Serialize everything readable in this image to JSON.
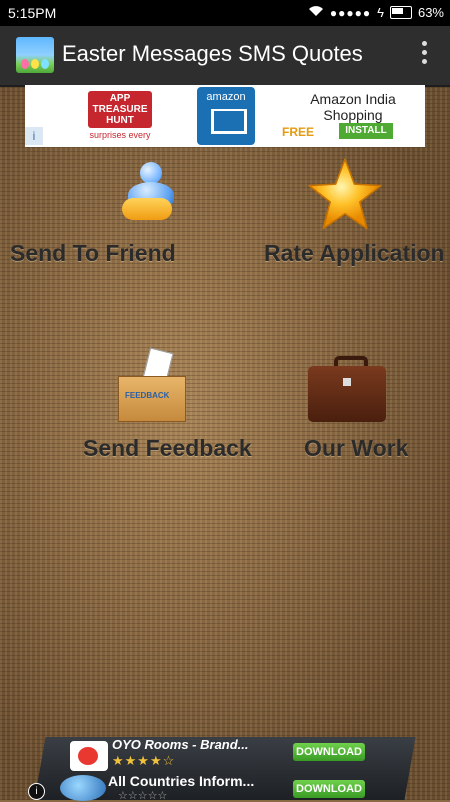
{
  "status_bar": {
    "time": "5:15PM",
    "signal": "●●●●●",
    "battery_pct": "63%"
  },
  "app_bar": {
    "title": "Easter Messages SMS Quotes"
  },
  "top_ad": {
    "left_brand_line1": "APP",
    "left_brand_line2": "TREASURE",
    "left_brand_line3": "HUNT",
    "left_tagline": "surprises every",
    "logo_text": "amazon",
    "title": "Amazon India Shopping",
    "price": "FREE",
    "cta": "INSTALL"
  },
  "menu": {
    "send_to_friend": "Send To Friend",
    "rate_application": "Rate Application",
    "send_feedback": "Send Feedback",
    "our_work": "Our Work",
    "feedback_box_text": "FEEDBACK"
  },
  "bottom_ad": {
    "item1_title": "OYO Rooms - Brand...",
    "item1_rating": "★★★★☆",
    "item1_cta": "DOWNLOAD",
    "item2_title": "All Countries Inform...",
    "item2_rating": "☆☆☆☆☆",
    "item2_cta": "DOWNLOAD"
  },
  "colors": {
    "status_bar": "#000000",
    "app_bar": "#2e2e2e",
    "background": "#8b6b45",
    "label_text": "#2b2b2b",
    "download_button": "#4eaa33"
  }
}
